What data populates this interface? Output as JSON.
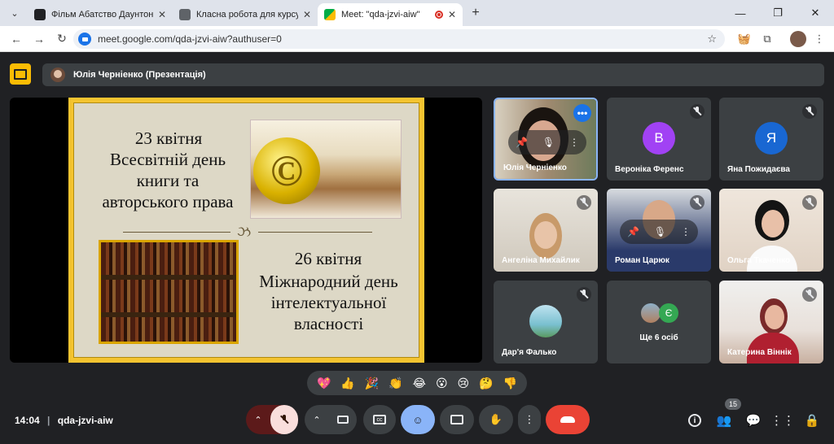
{
  "browser": {
    "tabs": [
      {
        "title": "Фільм Абатство Даунтон: Нова",
        "favicon_color": "#202124"
      },
      {
        "title": "Класна робота для курсу \"ЗАР",
        "favicon_color": "#444444"
      },
      {
        "title": "Meet: \"qda-jzvi-aiw\"",
        "favicon_color": "#00ac47"
      }
    ],
    "url": "meet.google.com/qda-jzvi-aiw?authuser=0"
  },
  "presentation": {
    "presenter_label": "Юлія Черніенко (Презентація)"
  },
  "slide": {
    "date1": "23 квітня",
    "title1_line1": "Всесвітній день",
    "title1_line2": "книги та",
    "title1_line3": "авторського права",
    "date2": "26 квітня",
    "title2_line1": "Міжнародний день",
    "title2_line2": "інтелектуальної",
    "title2_line3": "власності",
    "copyright_symbol": "©"
  },
  "participants": [
    {
      "name": "Юлія Черніенко",
      "type": "video",
      "active": true
    },
    {
      "name": "Вероніка Ференс",
      "type": "avatar",
      "initial": "В",
      "color": "#a142f4"
    },
    {
      "name": "Яна Пожидаєва",
      "type": "avatar",
      "initial": "Я",
      "color": "#1967d2"
    },
    {
      "name": "Ангеліна Михайлик",
      "type": "video"
    },
    {
      "name": "Роман Царюк",
      "type": "video"
    },
    {
      "name": "Ольга Ткаченко",
      "type": "video"
    },
    {
      "name": "Дар'я Фалько",
      "type": "avatar-photo"
    },
    {
      "name": "Ще 6 осіб",
      "type": "group",
      "initial": "Є",
      "color": "#34a853"
    },
    {
      "name": "Катерина Віннік",
      "type": "video"
    }
  ],
  "reactions": [
    "💖",
    "👍",
    "🎉",
    "👏",
    "😂",
    "😮",
    "😢",
    "🤔",
    "👎"
  ],
  "bottom_bar": {
    "time": "14:04",
    "meeting_code": "qda-jzvi-aiw",
    "participant_count": "15"
  }
}
